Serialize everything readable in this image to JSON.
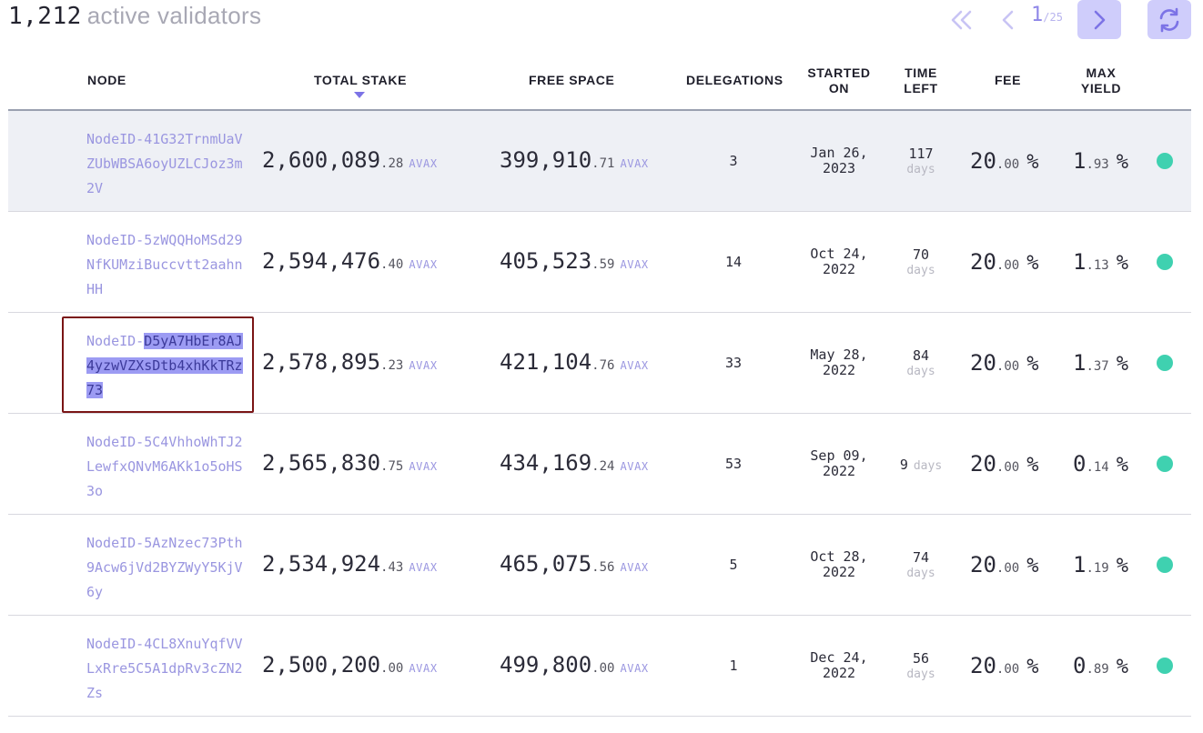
{
  "header": {
    "count": "1,212",
    "count_label": "active validators"
  },
  "pagination": {
    "current": "1",
    "total": "/25",
    "first_icon": "double-chevron-left-icon",
    "prev_icon": "chevron-left-icon",
    "next_icon": "chevron-right-icon",
    "refresh_icon": "refresh-icon"
  },
  "columns": {
    "node": "NODE",
    "total_stake": "TOTAL STAKE",
    "free_space": "FREE SPACE",
    "delegations": "DELEGATIONS",
    "started_on_1": "STARTED",
    "started_on_2": "ON",
    "time_left_1": "TIME",
    "time_left_2": "LEFT",
    "fee": "FEE",
    "max_yield_1": "MAX",
    "max_yield_2": "YIELD"
  },
  "colors": {
    "accent": "#9a96e0",
    "button_bg": "#cfcdfb",
    "status_active": "#3fd1b0",
    "selection_box": "#7a1515"
  },
  "rows": [
    {
      "node_prefix": "NodeID-41G32TrnmUaVZUbWBSA6oyUZLCJoz3m2V",
      "node_selected": "",
      "stake_int": "2,600,089",
      "stake_dec": ".28",
      "stake_unit": "AVAX",
      "free_int": "399,910",
      "free_dec": ".71",
      "free_unit": "AVAX",
      "delegations": "3",
      "started_1": "Jan 26,",
      "started_2": "2023",
      "time_num": "117",
      "time_unit": "days",
      "fee_int": "20",
      "fee_dec": ".00",
      "fee_sign": "%",
      "yield_int": "1",
      "yield_dec": ".93",
      "yield_sign": "%",
      "status": "active"
    },
    {
      "node_prefix": "NodeID-5zWQQHoMSd29NfKUMziBuccvtt2aahnHH",
      "node_selected": "",
      "stake_int": "2,594,476",
      "stake_dec": ".40",
      "stake_unit": "AVAX",
      "free_int": "405,523",
      "free_dec": ".59",
      "free_unit": "AVAX",
      "delegations": "14",
      "started_1": "Oct 24,",
      "started_2": "2022",
      "time_num": "70",
      "time_unit": "days",
      "fee_int": "20",
      "fee_dec": ".00",
      "fee_sign": "%",
      "yield_int": "1",
      "yield_dec": ".13",
      "yield_sign": "%",
      "status": "active"
    },
    {
      "node_prefix": "NodeID-",
      "node_selected": "D5yA7HbEr8AJ4yzwVZXsDtb4xhKkTRz73",
      "stake_int": "2,578,895",
      "stake_dec": ".23",
      "stake_unit": "AVAX",
      "free_int": "421,104",
      "free_dec": ".76",
      "free_unit": "AVAX",
      "delegations": "33",
      "started_1": "May 28,",
      "started_2": "2022",
      "time_num": "84",
      "time_unit": "days",
      "fee_int": "20",
      "fee_dec": ".00",
      "fee_sign": "%",
      "yield_int": "1",
      "yield_dec": ".37",
      "yield_sign": "%",
      "status": "active"
    },
    {
      "node_prefix": "NodeID-5C4VhhoWhTJ2LewfxQNvM6AKk1o5oHS3o",
      "node_selected": "",
      "stake_int": "2,565,830",
      "stake_dec": ".75",
      "stake_unit": "AVAX",
      "free_int": "434,169",
      "free_dec": ".24",
      "free_unit": "AVAX",
      "delegations": "53",
      "started_1": "Sep 09,",
      "started_2": "2022",
      "time_num": "9",
      "time_unit": "days",
      "fee_int": "20",
      "fee_dec": ".00",
      "fee_sign": "%",
      "yield_int": "0",
      "yield_dec": ".14",
      "yield_sign": "%",
      "status": "active"
    },
    {
      "node_prefix": "NodeID-5AzNzec73Pth9Acw6jVd2BYZWyY5KjV6y",
      "node_selected": "",
      "stake_int": "2,534,924",
      "stake_dec": ".43",
      "stake_unit": "AVAX",
      "free_int": "465,075",
      "free_dec": ".56",
      "free_unit": "AVAX",
      "delegations": "5",
      "started_1": "Oct 28,",
      "started_2": "2022",
      "time_num": "74",
      "time_unit": "days",
      "fee_int": "20",
      "fee_dec": ".00",
      "fee_sign": "%",
      "yield_int": "1",
      "yield_dec": ".19",
      "yield_sign": "%",
      "status": "active"
    },
    {
      "node_prefix": "NodeID-4CL8XnuYqfVVLxRre5C5A1dpRv3cZN2Zs",
      "node_selected": "",
      "stake_int": "2,500,200",
      "stake_dec": ".00",
      "stake_unit": "AVAX",
      "free_int": "499,800",
      "free_dec": ".00",
      "free_unit": "AVAX",
      "delegations": "1",
      "started_1": "Dec 24,",
      "started_2": "2022",
      "time_num": "56",
      "time_unit": "days",
      "fee_int": "20",
      "fee_dec": ".00",
      "fee_sign": "%",
      "yield_int": "0",
      "yield_dec": ".89",
      "yield_sign": "%",
      "status": "active"
    }
  ]
}
